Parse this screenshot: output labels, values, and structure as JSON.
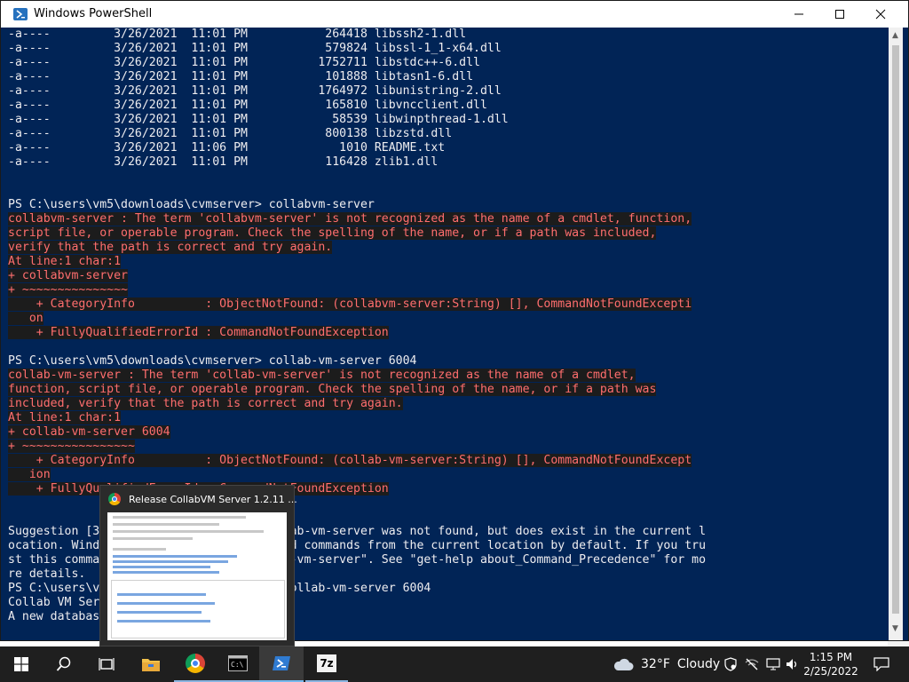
{
  "window": {
    "title": "Windows PowerShell",
    "icon": "powershell-icon",
    "buttons": {
      "minimize": "minimize-icon",
      "maximize": "maximize-icon",
      "close": "close-icon"
    }
  },
  "console": {
    "file_rows": [
      {
        "mode": "-a----",
        "date": "3/26/2021",
        "time": "11:01 PM",
        "size": "264418",
        "name": "libssh2-1.dll"
      },
      {
        "mode": "-a----",
        "date": "3/26/2021",
        "time": "11:01 PM",
        "size": "579824",
        "name": "libssl-1_1-x64.dll"
      },
      {
        "mode": "-a----",
        "date": "3/26/2021",
        "time": "11:01 PM",
        "size": "1752711",
        "name": "libstdc++-6.dll"
      },
      {
        "mode": "-a----",
        "date": "3/26/2021",
        "time": "11:01 PM",
        "size": "101888",
        "name": "libtasn1-6.dll"
      },
      {
        "mode": "-a----",
        "date": "3/26/2021",
        "time": "11:01 PM",
        "size": "1764972",
        "name": "libunistring-2.dll"
      },
      {
        "mode": "-a----",
        "date": "3/26/2021",
        "time": "11:01 PM",
        "size": "165810",
        "name": "libvncclient.dll"
      },
      {
        "mode": "-a----",
        "date": "3/26/2021",
        "time": "11:01 PM",
        "size": "58539",
        "name": "libwinpthread-1.dll"
      },
      {
        "mode": "-a----",
        "date": "3/26/2021",
        "time": "11:01 PM",
        "size": "800138",
        "name": "libzstd.dll"
      },
      {
        "mode": "-a----",
        "date": "3/26/2021",
        "time": "11:06 PM",
        "size": "1010",
        "name": "README.txt"
      },
      {
        "mode": "-a----",
        "date": "3/26/2021",
        "time": "11:01 PM",
        "size": "116428",
        "name": "zlib1.dll"
      }
    ],
    "prompt1": "PS C:\\users\\vm5\\downloads\\cvmserver> collabvm-server",
    "error1": [
      "collabvm-server : The term 'collabvm-server' is not recognized as the name of a cmdlet, function,",
      "script file, or operable program. Check the spelling of the name, or if a path was included,",
      "verify that the path is correct and try again.",
      "At line:1 char:1",
      "+ collabvm-server",
      "+ ~~~~~~~~~~~~~~~",
      "    + CategoryInfo          : ObjectNotFound: (collabvm-server:String) [], CommandNotFoundExcepti",
      "   on",
      "    + FullyQualifiedErrorId : CommandNotFoundException"
    ],
    "prompt2": "PS C:\\users\\vm5\\downloads\\cvmserver> collab-vm-server 6004",
    "error2": [
      "collab-vm-server : The term 'collab-vm-server' is not recognized as the name of a cmdlet,",
      "function, script file, or operable program. Check the spelling of the name, or if a path was",
      "included, verify that the path is correct and try again.",
      "At line:1 char:1",
      "+ collab-vm-server 6004",
      "+ ~~~~~~~~~~~~~~~~",
      "    + CategoryInfo          : ObjectNotFound: (collab-vm-server:String) [], CommandNotFoundExcept",
      "   ion",
      "    + FullyQualifiedErrorId : CommandNotFoundException"
    ],
    "suggestion": [
      "Suggestion [3,General]: The command collab-vm-server was not found, but does exist in the current l",
      "ocation. Windows PowerShell does not load commands from the current location by default. If you tru",
      "st this command, instead type: \".\\collab-vm-server\". See \"get-help about_Command_Precedence\" for mo",
      "re details."
    ],
    "prompt3": "PS C:\\users\\vm5\\downloads\\cvmserver> .\\collab-vm-server 6004",
    "output": [
      "Collab VM Server 1.2.11",
      "A new database"
    ]
  },
  "preview": {
    "title": "Release CollabVM Server 1.2.11 ...",
    "app_icon": "chrome-icon"
  },
  "taskbar": {
    "start": "windows-start-icon",
    "search": "search-icon",
    "task_view": "task-view-icon",
    "apps": [
      {
        "name": "file-explorer",
        "icon": "folder-icon"
      },
      {
        "name": "chrome",
        "icon": "chrome-icon"
      },
      {
        "name": "command-prompt",
        "icon": "cmd-icon"
      },
      {
        "name": "powershell",
        "icon": "powershell-icon"
      },
      {
        "name": "7zip",
        "icon": "7zip-icon",
        "label": "7z"
      }
    ],
    "weather": {
      "temp": "32°F",
      "condition": "Cloudy",
      "icon": "cloud-icon"
    },
    "clock": {
      "time": "1:15 PM",
      "date": "2/25/2022"
    }
  },
  "colors": {
    "console_bg": "#012456",
    "console_fg": "#eeedf0",
    "error_fg": "#ff5c5c",
    "taskbar_bg": "#1f1f1f"
  }
}
